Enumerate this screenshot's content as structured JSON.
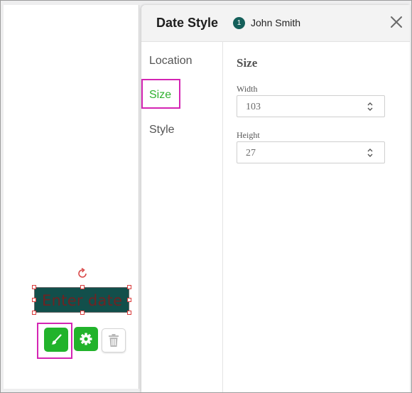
{
  "canvas": {
    "date_field_placeholder": "Enter date",
    "toolbar": {
      "style_icon": "brush-icon",
      "settings_icon": "gear-icon",
      "delete_icon": "trash-icon",
      "accent_color": "#21b32b"
    },
    "rotate_icon": "rotate-icon"
  },
  "panel": {
    "title": "Date Style",
    "assignee": {
      "number": "1",
      "name": "John Smith"
    },
    "close_icon": "close-icon",
    "nav": [
      {
        "label": "Location",
        "active": false
      },
      {
        "label": "Size",
        "active": true
      },
      {
        "label": "Style",
        "active": false
      }
    ],
    "size": {
      "heading": "Size",
      "width_label": "Width",
      "width_value": "103",
      "height_label": "Height",
      "height_value": "27"
    }
  },
  "colors": {
    "field_fill": "#124f4b",
    "active_nav": "#2fb12f",
    "highlight": "#d425b3"
  }
}
